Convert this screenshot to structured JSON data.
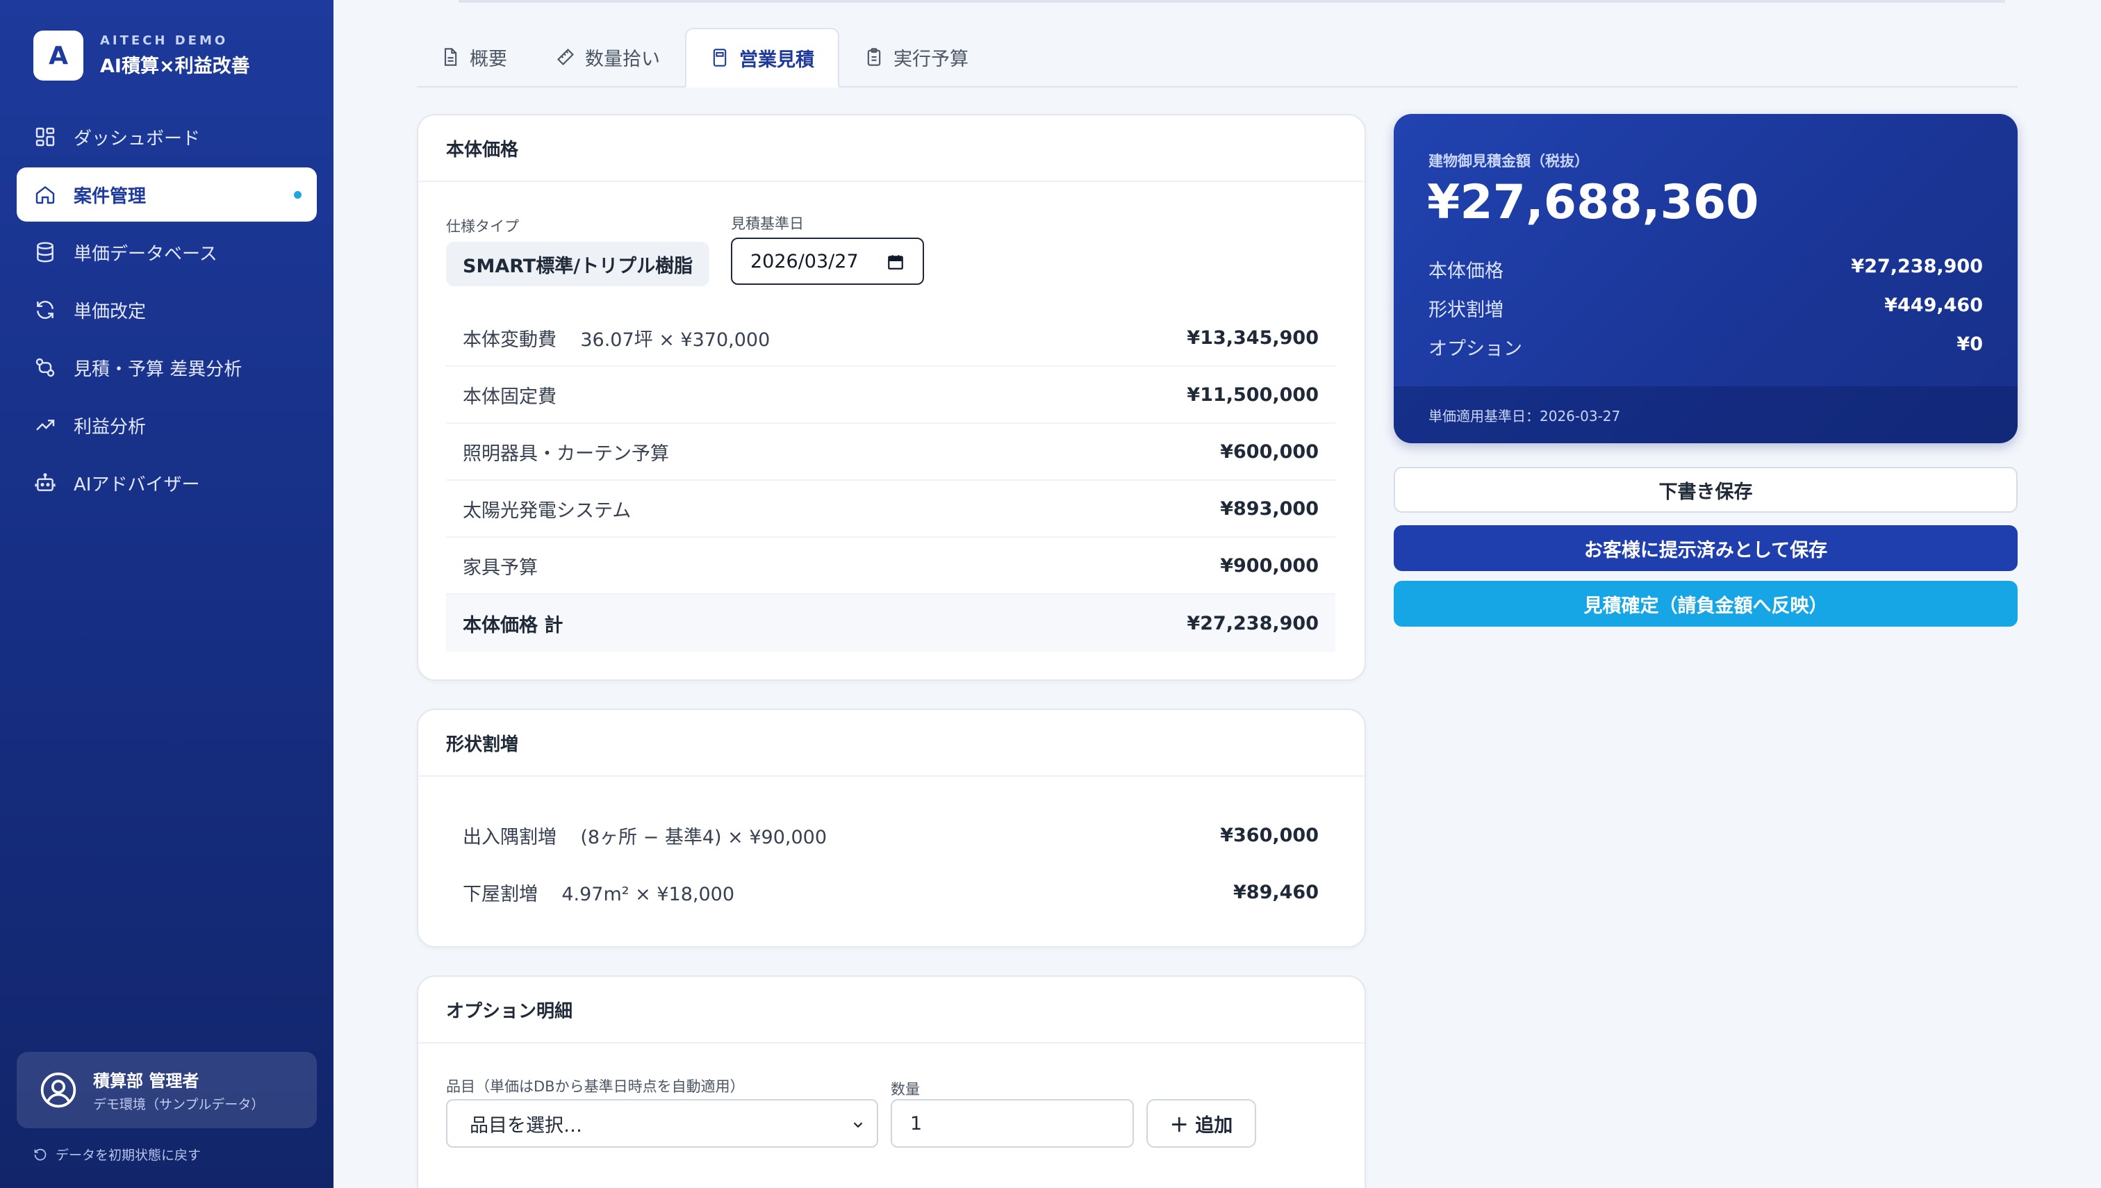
{
  "brand": {
    "logo_letter": "A",
    "sub": "AITECH DEMO",
    "title": "AI積算×利益改善"
  },
  "sidebar": {
    "items": [
      {
        "label": "ダッシュボード",
        "icon": "dashboard-icon"
      },
      {
        "label": "案件管理",
        "icon": "home-icon",
        "active": true
      },
      {
        "label": "単価データベース",
        "icon": "database-icon"
      },
      {
        "label": "単価改定",
        "icon": "refresh-icon"
      },
      {
        "label": "見積・予算 差異分析",
        "icon": "compare-icon"
      },
      {
        "label": "利益分析",
        "icon": "trend-icon"
      },
      {
        "label": "AIアドバイザー",
        "icon": "bot-icon"
      }
    ],
    "user": {
      "name": "積算部 管理者",
      "env": "デモ環境（サンプルデータ）"
    },
    "reset_label": "データを初期状態に戻す"
  },
  "tabs": [
    {
      "label": "概要",
      "icon": "document-icon"
    },
    {
      "label": "数量拾い",
      "icon": "ruler-icon"
    },
    {
      "label": "営業見積",
      "icon": "calculator-icon",
      "active": true
    },
    {
      "label": "実行予算",
      "icon": "clipboard-icon"
    }
  ],
  "body_price": {
    "title": "本体価格",
    "spec_label": "仕様タイプ",
    "spec_value": "SMART標準/トリプル樹脂",
    "date_label": "見積基準日",
    "date_value": "2026/03/27",
    "rows": [
      {
        "label": "本体変動費",
        "detail": "36.07坪 × ¥370,000",
        "value": "¥13,345,900"
      },
      {
        "label": "本体固定費",
        "detail": "",
        "value": "¥11,500,000"
      },
      {
        "label": "照明器具・カーテン予算",
        "detail": "",
        "value": "¥600,000"
      },
      {
        "label": "太陽光発電システム",
        "detail": "",
        "value": "¥893,000"
      },
      {
        "label": "家具予算",
        "detail": "",
        "value": "¥900,000"
      }
    ],
    "total_label": "本体価格 計",
    "total_value": "¥27,238,900"
  },
  "shape_surcharge": {
    "title": "形状割増",
    "rows": [
      {
        "label": "出入隅割増",
        "detail": "(8ヶ所 − 基準4) × ¥90,000",
        "value": "¥360,000"
      },
      {
        "label": "下屋割増",
        "detail": "4.97m² × ¥18,000",
        "value": "¥89,460"
      }
    ]
  },
  "options": {
    "title": "オプション明細",
    "item_label": "品目（単価はDBから基準日時点を自動適用）",
    "item_placeholder": "品目を選択…",
    "qty_label": "数量",
    "qty_value": "1",
    "add_label": "＋ 追加"
  },
  "summary": {
    "label": "建物御見積金額（税抜）",
    "amount": "¥27,688,360",
    "rows": [
      {
        "label": "本体価格",
        "value": "¥27,238,900"
      },
      {
        "label": "形状割増",
        "value": "¥449,460"
      },
      {
        "label": "オプション",
        "value": "¥0"
      }
    ],
    "footer": "単価適用基準日：2026-03-27"
  },
  "actions": {
    "draft": "下書き保存",
    "present": "お客様に提示済みとして保存",
    "confirm": "見積確定（請負金額へ反映）"
  },
  "colors": {
    "sidebar": "#1d3a9c",
    "accent": "#16a6e6",
    "primary_button": "#1f3fae"
  }
}
